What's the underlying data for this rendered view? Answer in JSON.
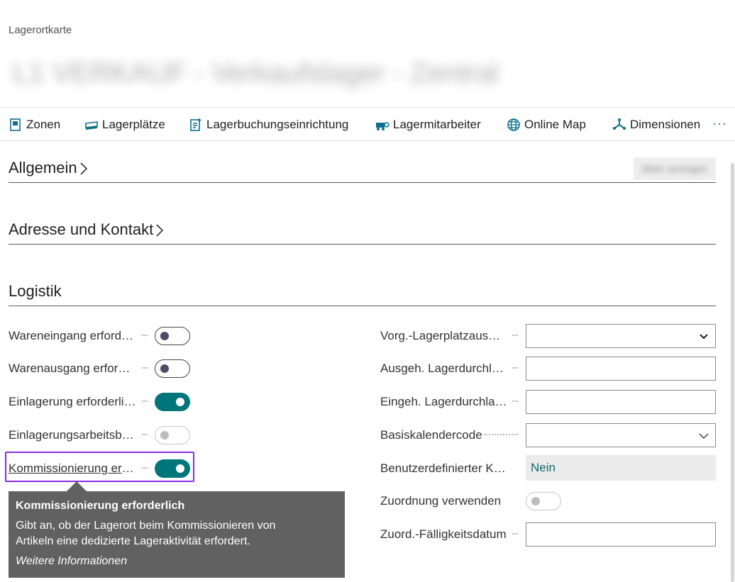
{
  "header": {
    "caption": "Lagerortkarte",
    "title": "L1 VERKAUF - Verkaufslager - Zentral"
  },
  "actions": [
    {
      "label": "Zonen",
      "icon": "zones-icon"
    },
    {
      "label": "Lagerplätze",
      "icon": "bins-icon"
    },
    {
      "label": "Lagerbuchungseinrichtung",
      "icon": "posting-setup-icon"
    },
    {
      "label": "Lagermitarbeiter",
      "icon": "employees-icon"
    },
    {
      "label": "Online Map",
      "icon": "globe-icon"
    },
    {
      "label": "Dimensionen",
      "icon": "dimensions-icon"
    }
  ],
  "more_label": "···",
  "sections": {
    "general": "Allgemein",
    "address": "Adresse und Kontakt",
    "logistics": "Logistik",
    "show_more": "Mehr anzeigen"
  },
  "left_fields": [
    {
      "label": "Wareneingang erforderlich",
      "state": "off"
    },
    {
      "label": "Warenausgang erforderlich",
      "state": "off"
    },
    {
      "label": "Einlagerung erforderlich",
      "state": "on"
    },
    {
      "label": "Einlagerungsarbeitsblatt verwenden",
      "state": "disabled"
    },
    {
      "label": "Kommissionierung erforderlich",
      "state": "on"
    }
  ],
  "right_fields": [
    {
      "label": "Vorg.-Lagerplatzauswahl",
      "kind": "select",
      "value": ""
    },
    {
      "label": "Ausgeh. Lagerdurchlaufzeit",
      "kind": "text",
      "value": ""
    },
    {
      "label": "Eingeh. Lagerdurchlaufzeit",
      "kind": "text",
      "value": ""
    },
    {
      "label": "Basiskalendercode",
      "kind": "select",
      "value": ""
    },
    {
      "label": "Benutzerdefinierter Kalender",
      "kind": "readonly",
      "value": "Nein"
    },
    {
      "label": "Zuordnung verwenden",
      "kind": "toggle",
      "value": "off"
    },
    {
      "label": "Zuord.-Fälligkeitsdatum",
      "kind": "text",
      "value": ""
    }
  ],
  "tooltip": {
    "title": "Kommissionierung erforderlich",
    "body": "Gibt an, ob der Lagerort beim Kommissionieren von Artikeln eine dedizierte Lageraktivität erfordert.",
    "link": "Weitere Informationen"
  },
  "colors": {
    "accent": "#00767a",
    "focus": "#8a2be2",
    "tooltip_bg": "#616161"
  }
}
